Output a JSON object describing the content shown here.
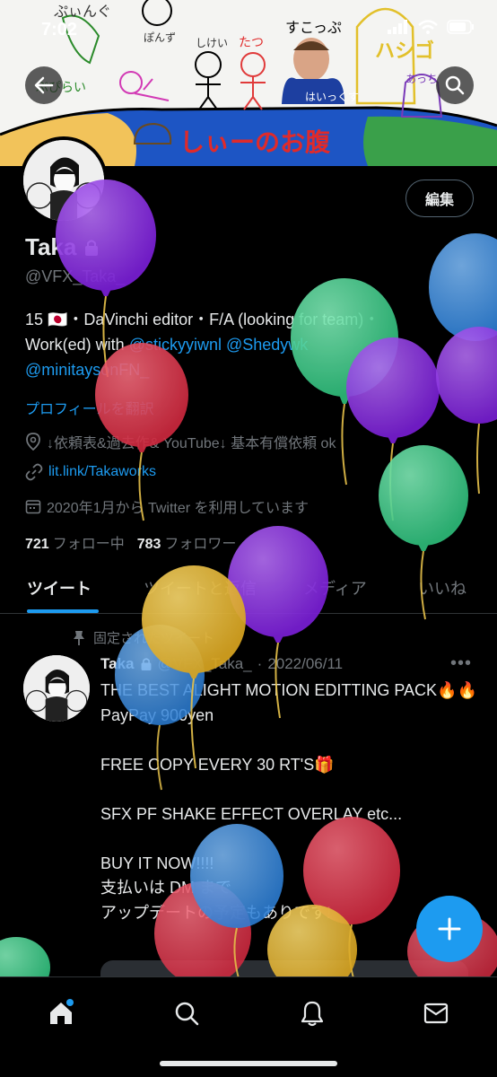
{
  "status": {
    "time": "7:02"
  },
  "header": {
    "back_icon": "back-arrow-icon",
    "search_icon": "search-icon"
  },
  "banner": {
    "doodles": [
      "ぷぃんぐ",
      "ぽんず",
      "しけい",
      "たつ",
      "すこっぷ",
      "ハシゴ",
      "あっち",
      "ぷぴらい",
      "はいっくす",
      "しぃーのお腹"
    ]
  },
  "profile": {
    "edit_label": "編集",
    "name": "Taka",
    "handle": "@VFX_Taka_",
    "bio_line1": "15 🇯🇵・DaVinchi editor・F/A (looking for team)・",
    "bio_line2_prefix": "Work(ed) with ",
    "bio_mention1": "@stickyyiwnl",
    "bio_mention2": "@Shedywk",
    "bio_mention3": "@minitaysonFN_",
    "translate": "プロフィールを翻訳",
    "location": "↓依頼表&過去作& YouTube↓ 基本有償依頼 ok",
    "link": "lit.link/Takaworks",
    "joined": "2020年1月から Twitter を利用しています",
    "following_count": "721",
    "following_label": "フォロー中",
    "followers_count": "783",
    "followers_label": "フォロワー"
  },
  "tabs": [
    {
      "label": "ツイート",
      "active": true
    },
    {
      "label": "ツイートと返信",
      "active": false
    },
    {
      "label": "メディア",
      "active": false
    },
    {
      "label": "いいね",
      "active": false
    }
  ],
  "tweet": {
    "pinned_label": "固定されたツイート",
    "author": "Taka",
    "handle": "@VFX_Taka_",
    "date": "2022/06/11",
    "body": "THE BEST ALIGHT MOTION EDITTING PACK🔥🔥\nPayPay 900yen\n\nFREE COPY EVERY 30 RT'S🎁\n\nSFX PF SHAKE EFFECT OVERLAY etc...\n\nBUY IT NOW!!!!\n支払いは DM まで\nアップデートの予定もありです!"
  },
  "fab": {
    "icon": "compose-plus-icon",
    "label": "+"
  },
  "bottom_nav": [
    {
      "icon": "home-icon"
    },
    {
      "icon": "search-icon"
    },
    {
      "icon": "bell-icon"
    },
    {
      "icon": "mail-icon"
    }
  ],
  "colors": {
    "accent": "#1d9bf0",
    "balloon_purple": "#8a2be2",
    "balloon_green": "#3ecf8e",
    "balloon_red": "#e03a4e",
    "balloon_blue": "#3b8fe0",
    "balloon_yellow": "#e8b935"
  }
}
